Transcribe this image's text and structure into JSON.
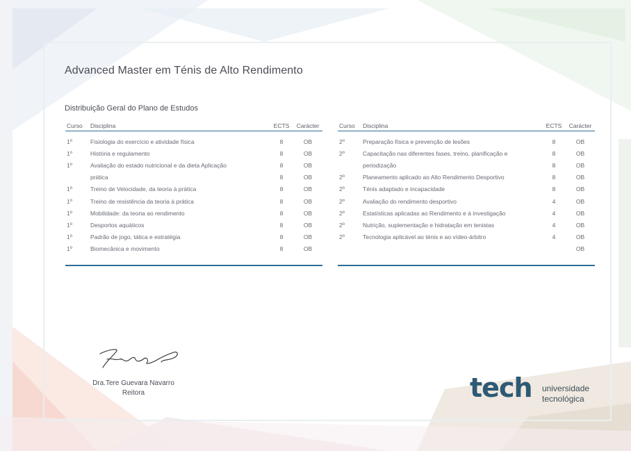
{
  "colors": {
    "accent": "#2d6d95",
    "logo": "#2d5a74"
  },
  "title": "Advanced Master em Ténis de Alto Rendimento",
  "subtitle": "Distribuição Geral do Plano de Estudos",
  "headers": {
    "curso": "Curso",
    "disciplina": "Disciplina",
    "ects": "ECTS",
    "caracter": "Carácter"
  },
  "left_rows": [
    {
      "curso": "1º",
      "disciplina": "Fisiologia do exercício e atividade física",
      "ects": "8",
      "caracter": "OB"
    },
    {
      "curso": "1º",
      "disciplina": "História e regulamento",
      "ects": "8",
      "caracter": "OB"
    },
    {
      "curso": "1º",
      "disciplina": "Avaliação do estado nutricional e da dieta Aplicação",
      "ects": "8",
      "caracter": "OB"
    },
    {
      "curso": "",
      "disciplina": "prática",
      "ects": "8",
      "caracter": "OB"
    },
    {
      "curso": "1º",
      "disciplina": "Treino de Velocidade, da teoria à prática",
      "ects": "8",
      "caracter": "OB"
    },
    {
      "curso": "1º",
      "disciplina": "Treino de resistência da teoria à prática",
      "ects": "8",
      "caracter": "OB"
    },
    {
      "curso": "1º",
      "disciplina": "Mobilidade: da teoria ao rendimento",
      "ects": "8",
      "caracter": "OB"
    },
    {
      "curso": "1º",
      "disciplina": "Desportos aquáticos",
      "ects": "8",
      "caracter": "OB"
    },
    {
      "curso": "1º",
      "disciplina": "Padrão de jogo, tática e estratégia",
      "ects": "8",
      "caracter": "OB"
    },
    {
      "curso": "1º",
      "disciplina": "Biomecânica e movimento",
      "ects": "8",
      "caracter": "OB"
    }
  ],
  "right_rows": [
    {
      "curso": "2º",
      "disciplina": "Preparação física e prevenção de lesões",
      "ects": "8",
      "caracter": "OB"
    },
    {
      "curso": "2º",
      "disciplina": "Capacitação nas diferentes fases, treino, planificação e",
      "ects": "8",
      "caracter": "OB"
    },
    {
      "curso": "",
      "disciplina": "periodização",
      "ects": "8",
      "caracter": "OB"
    },
    {
      "curso": "2º",
      "disciplina": "Planeamento aplicado ao Alto Rendimento Desportivo",
      "ects": "8",
      "caracter": "OB"
    },
    {
      "curso": "2º",
      "disciplina": "Ténis adaptado e incapacidade",
      "ects": "8",
      "caracter": "OB"
    },
    {
      "curso": "2º",
      "disciplina": "Avaliação do rendimento desportivo",
      "ects": "4",
      "caracter": "OB"
    },
    {
      "curso": "2º",
      "disciplina": "Estatísticas aplicadas ao Rendimento e à investigação",
      "ects": "4",
      "caracter": "OB"
    },
    {
      "curso": "2º",
      "disciplina": "Nutrição, suplementação e hidratação em tenistas",
      "ects": "4",
      "caracter": "OB"
    },
    {
      "curso": "2º",
      "disciplina": "Tecnologia aplicável ao ténis e ao vídeo-árbitro",
      "ects": "4",
      "caracter": "OB"
    },
    {
      "curso": "",
      "disciplina": "",
      "ects": "",
      "caracter": "OB"
    }
  ],
  "signatory": {
    "name": "Dra.Tere Guevara Navarro",
    "role": "Reitora"
  },
  "logo": {
    "word": "tech",
    "line1": "universidade",
    "line2": "tecnológica"
  }
}
